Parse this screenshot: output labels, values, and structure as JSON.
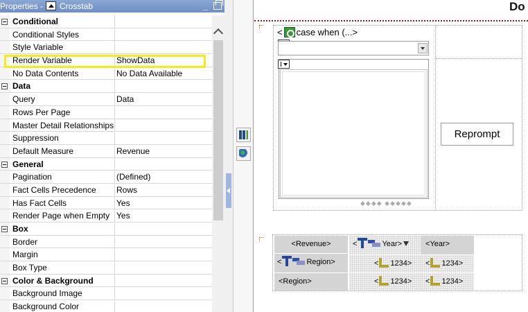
{
  "panel": {
    "title": "Properties",
    "separator": "-",
    "object_type": "Crosstab",
    "minimize_glyph": "_"
  },
  "properties": [
    {
      "type": "group",
      "name": "Conditional",
      "value": ""
    },
    {
      "type": "prop",
      "name": "Conditional Styles",
      "value": ""
    },
    {
      "type": "prop",
      "name": "Style Variable",
      "value": ""
    },
    {
      "type": "prop",
      "name": "Render Variable",
      "value": "ShowData",
      "highlighted": true
    },
    {
      "type": "prop",
      "name": "No Data Contents",
      "value": "No Data Available"
    },
    {
      "type": "group",
      "name": "Data",
      "value": ""
    },
    {
      "type": "prop",
      "name": "Query",
      "value": "Data"
    },
    {
      "type": "prop",
      "name": "Rows Per Page",
      "value": ""
    },
    {
      "type": "prop",
      "name": "Master Detail Relationships",
      "value": ""
    },
    {
      "type": "prop",
      "name": "Suppression",
      "value": ""
    },
    {
      "type": "prop",
      "name": "Default Measure",
      "value": "Revenue"
    },
    {
      "type": "group",
      "name": "General",
      "value": ""
    },
    {
      "type": "prop",
      "name": "Pagination",
      "value": "(Defined)"
    },
    {
      "type": "prop",
      "name": "Fact Cells Precedence",
      "value": "Rows"
    },
    {
      "type": "prop",
      "name": "Has Fact Cells",
      "value": "Yes"
    },
    {
      "type": "prop",
      "name": "Render Page when Empty",
      "value": "Yes"
    },
    {
      "type": "group",
      "name": "Box",
      "value": ""
    },
    {
      "type": "prop",
      "name": "Border",
      "value": ""
    },
    {
      "type": "prop",
      "name": "Margin",
      "value": ""
    },
    {
      "type": "prop",
      "name": "Box Type",
      "value": ""
    },
    {
      "type": "group",
      "name": "Color & Background",
      "value": ""
    },
    {
      "type": "prop",
      "name": "Background Image",
      "value": ""
    },
    {
      "type": "prop",
      "name": "Background Color",
      "value": ""
    }
  ],
  "highlight_color": "#f5ee16",
  "tools": [
    {
      "name": "crosstab-tool",
      "icon": "crosstab-insert-icon"
    },
    {
      "name": "tree-tool",
      "icon": "tree-prompt-icon"
    }
  ],
  "report": {
    "page_header": "Do",
    "case_label_prefix": "<",
    "case_label": "case when (...>",
    "pager_glyphs": "◆◆◆◆  ◆◆◆◆◆",
    "reprompt_label": "Reprompt",
    "crosstab": {
      "measure": "<Revenue>",
      "col_lt": "<",
      "col_header": "Year>",
      "col_member": "<Year>",
      "row_lt": "<",
      "row_header": "Region>",
      "row_member": "<Region>",
      "cell_lt": "<",
      "cell_value": "1234>"
    }
  }
}
